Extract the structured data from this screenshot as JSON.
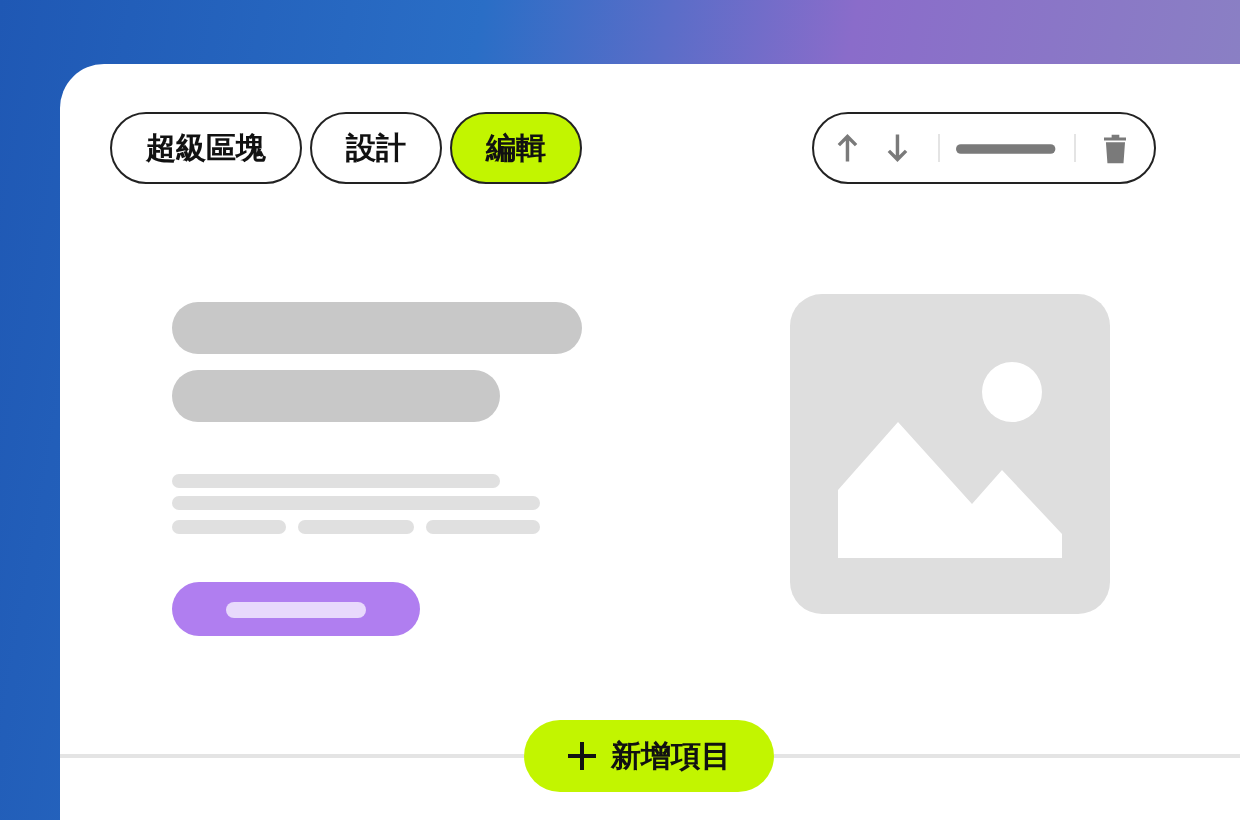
{
  "tabs": [
    {
      "label": "超級區塊",
      "selected": false
    },
    {
      "label": "設計",
      "selected": false
    },
    {
      "label": "編輯",
      "selected": true
    }
  ],
  "add_button": {
    "label": "新增項目"
  }
}
